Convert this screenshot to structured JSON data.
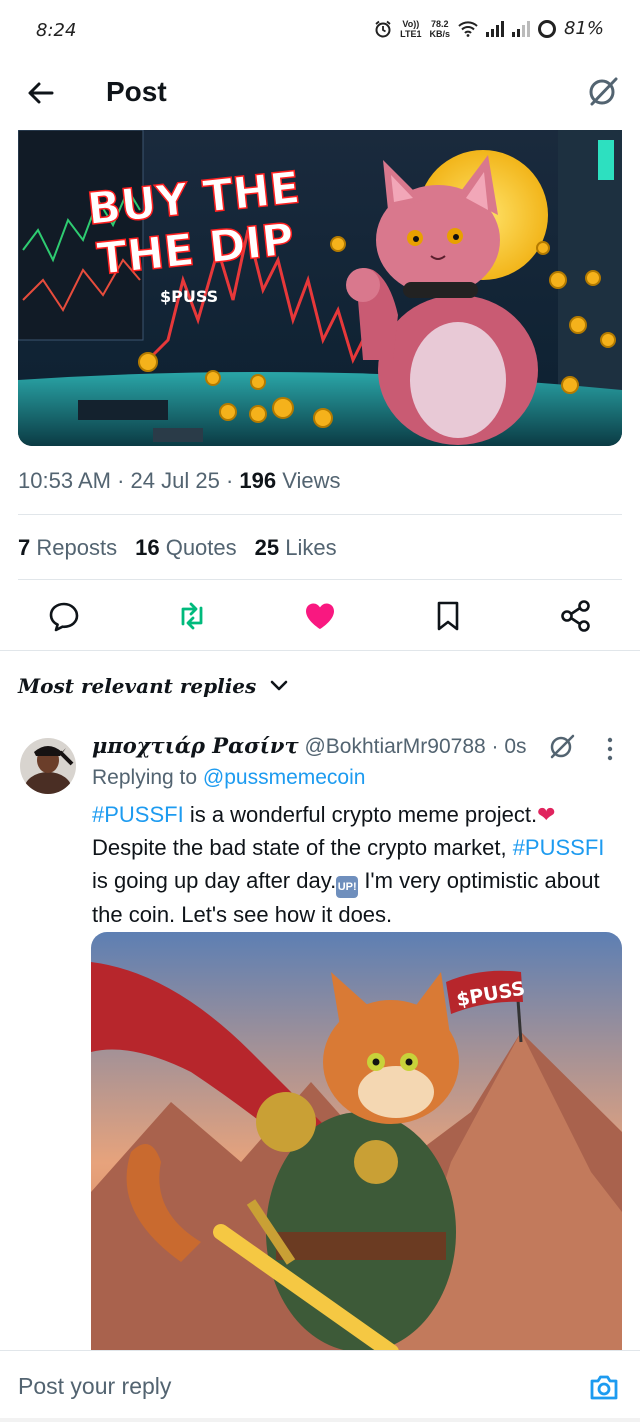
{
  "status_bar": {
    "time": "8:24",
    "network_top": "78.2",
    "network_bottom": "KB/s",
    "volte_top": "Vo))",
    "volte_bottom": "LTE1",
    "battery": "81%",
    "icons": [
      "alarm-icon",
      "wifi-icon",
      "signal-icon",
      "signal-icon",
      "battery-ring-icon"
    ]
  },
  "header": {
    "title": "Post",
    "back_icon": "arrow-left-icon",
    "grok_icon": "grok-icon"
  },
  "post": {
    "image_alt": "BUY THE DIP",
    "image_text_line1": "BUY THE",
    "image_text_line2": "THE DIP",
    "image_ticker": "$PUSS",
    "time": "10:53 AM",
    "date": "24 Jul 25",
    "views_count": "196",
    "views_label": "Views",
    "sep": "·"
  },
  "stats": {
    "reposts_count": "7",
    "reposts_label": "Reposts",
    "quotes_count": "16",
    "quotes_label": "Quotes",
    "likes_count": "25",
    "likes_label": "Likes"
  },
  "actions": {
    "reply_icon": "comment-icon",
    "repost_icon": "repost-icon",
    "like_icon": "heart-icon",
    "bookmark_icon": "bookmark-icon",
    "share_icon": "share-icon",
    "repost_color": "#00ba7c",
    "like_color": "#f91880"
  },
  "replies": {
    "sort_label": "Most relevant replies",
    "items": [
      {
        "name": "μποχτιάρ Ρασίντ",
        "handle": "@BokhtiarMr90788",
        "dot": "·",
        "time": "0s",
        "replying_prefix": "Replying to",
        "replying_to": "@pussmemecoin",
        "hashtag1": "#PUSSFI",
        "text1": " is a wonderful crypto meme project.",
        "text2": " Despite the bad state of the crypto market,",
        "hashtag2": "#PUSSFI",
        "text3": " is going up day after day.",
        "emoji_up": "UP!",
        "text4": " I'm very optimistic about the coin. Let's see how it does.",
        "image_flag_text": "$PUSS"
      }
    ]
  },
  "composer": {
    "placeholder": "Post your reply",
    "camera_icon": "camera-icon"
  },
  "colors": {
    "accent": "#1d9bf0",
    "text_primary": "#0f1419",
    "text_secondary": "#536471"
  }
}
